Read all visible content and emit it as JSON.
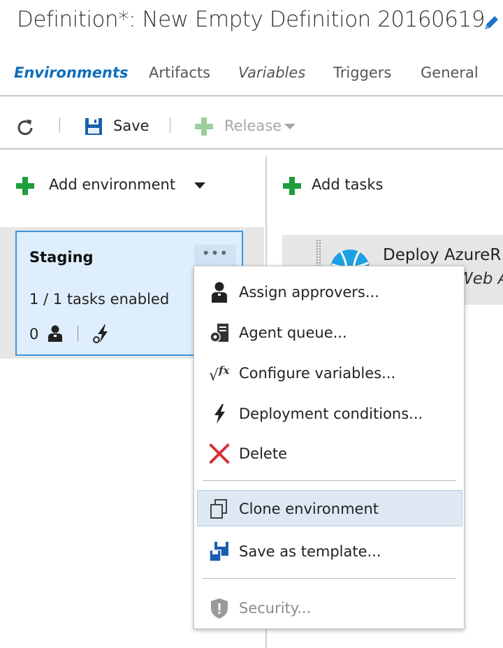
{
  "header": {
    "title": "Definition*: New Empty Definition 20160619"
  },
  "tabs": [
    {
      "label": "Environments"
    },
    {
      "label": "Artifacts"
    },
    {
      "label": "Variables"
    },
    {
      "label": "Triggers"
    },
    {
      "label": "General"
    }
  ],
  "toolbar": {
    "save_label": "Save",
    "release_label": "Release"
  },
  "environments_pane": {
    "add_environment_label": "Add environment"
  },
  "environment_card": {
    "name": "Staging",
    "tasks_enabled": "1 / 1 tasks enabled",
    "approver_count": "0",
    "more_label": "•••"
  },
  "tasks_pane": {
    "add_tasks_label": "Add tasks",
    "task": {
      "title": "Deploy AzureR",
      "subtitle": "Web A"
    }
  },
  "context_menu": {
    "items": [
      {
        "label": "Assign approvers...",
        "icon": "person-icon"
      },
      {
        "label": "Agent queue...",
        "icon": "agent-queue-icon"
      },
      {
        "label": "Configure variables...",
        "icon": "fx-icon"
      },
      {
        "label": "Deployment conditions...",
        "icon": "lightning-icon"
      },
      {
        "label": "Delete",
        "icon": "delete-x-icon"
      },
      {
        "label": "Clone environment",
        "icon": "clone-icon",
        "state": "hovered"
      },
      {
        "label": "Save as template...",
        "icon": "save-template-icon"
      },
      {
        "label": "Security...",
        "icon": "shield-icon",
        "state": "disabled"
      }
    ]
  },
  "colors": {
    "accent": "#106ebe",
    "add_green": "#1e9e3a",
    "card_fill": "#deeefc",
    "card_border": "#3a96dd",
    "delete_red": "#d13438",
    "menu_hover": "#dde8f3"
  }
}
